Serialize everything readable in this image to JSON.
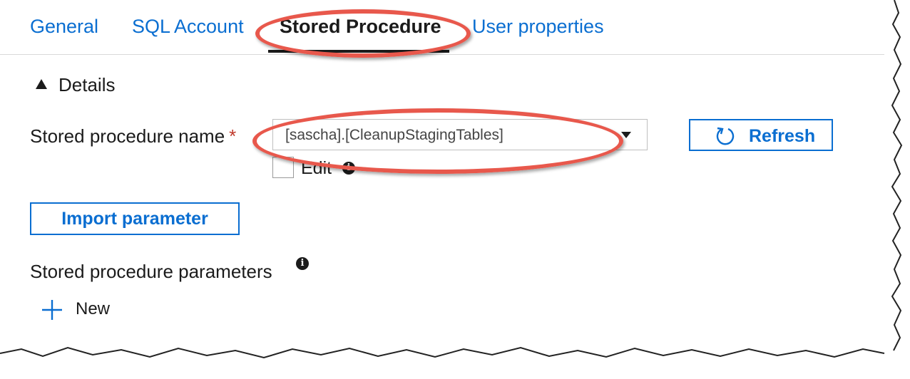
{
  "tabs": [
    {
      "label": "General"
    },
    {
      "label": "SQL Account"
    },
    {
      "label": "Stored Procedure"
    },
    {
      "label": "User properties"
    }
  ],
  "details": {
    "toggle_label": "Details"
  },
  "stored_procedure": {
    "label": "Stored procedure name",
    "required_marker": "*",
    "selected_value": "[sascha].[CleanupStagingTables]",
    "refresh_label": "Refresh",
    "edit_label": "Edit",
    "info_glyph": "i"
  },
  "parameters": {
    "import_label": "Import parameter",
    "section_label": "Stored procedure parameters",
    "info_glyph": "i",
    "new_label": "New"
  },
  "colors": {
    "accent": "#0a6ed1",
    "highlight": "#e8584c",
    "required": "#c0392b"
  },
  "icons": {
    "refresh": "refresh-icon",
    "add": "plus-icon",
    "collapse": "triangle-up-icon",
    "info": "info-icon"
  }
}
